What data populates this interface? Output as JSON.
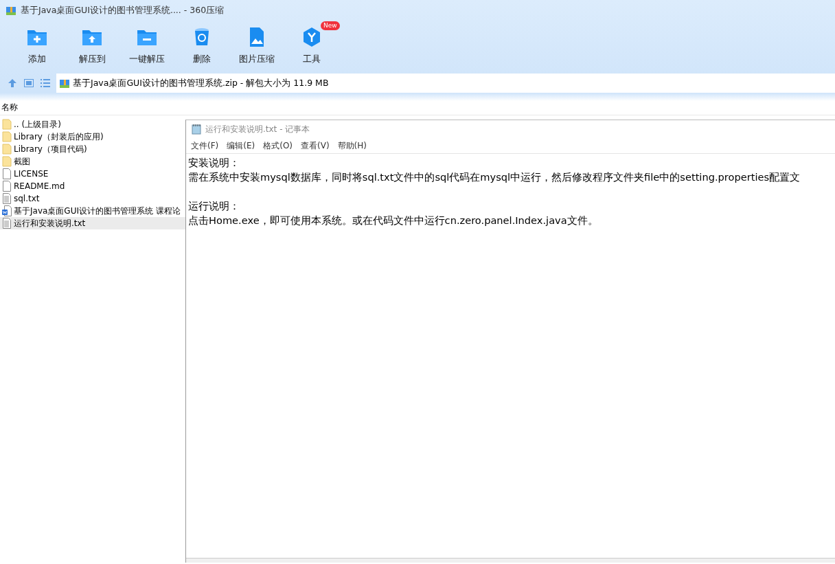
{
  "window": {
    "title": "基于Java桌面GUI设计的图书管理系统.... - 360压缩"
  },
  "toolbar": [
    {
      "label": "添加",
      "kind": "add"
    },
    {
      "label": "解压到",
      "kind": "extract"
    },
    {
      "label": "一键解压",
      "kind": "quick"
    },
    {
      "label": "删除",
      "kind": "delete"
    },
    {
      "label": "图片压缩",
      "kind": "image"
    },
    {
      "label": "工具",
      "kind": "tools",
      "badge": "New"
    }
  ],
  "address_bar": {
    "value": "基于Java桌面GUI设计的图书管理系统.zip - 解包大小为 11.9 MB"
  },
  "file_list": {
    "column": "名称",
    "items": [
      {
        "name": ".. (上级目录)",
        "kind": "folder",
        "selected": false
      },
      {
        "name": "Library（封装后的应用)",
        "kind": "folder",
        "selected": false
      },
      {
        "name": "Library（项目代码)",
        "kind": "folder",
        "selected": false
      },
      {
        "name": "截图",
        "kind": "folder",
        "selected": false
      },
      {
        "name": "LICENSE",
        "kind": "file",
        "selected": false
      },
      {
        "name": "README.md",
        "kind": "file",
        "selected": false
      },
      {
        "name": "sql.txt",
        "kind": "text",
        "selected": false
      },
      {
        "name": "基于Java桌面GUI设计的图书管理系统 课程论",
        "kind": "doc",
        "selected": false
      },
      {
        "name": "运行和安装说明.txt",
        "kind": "text",
        "selected": true
      }
    ]
  },
  "notepad": {
    "title": "运行和安装说明.txt - 记事本",
    "menu": [
      "文件(F)",
      "编辑(E)",
      "格式(O)",
      "查看(V)",
      "帮助(H)"
    ],
    "sections": [
      {
        "lines": [
          "安装说明：",
          "需在系统中安装mysql数据库，同时将sql.txt文件中的sql代码在mysql中运行，然后修改程序文件夹file中的setting.properties配置文"
        ]
      },
      {
        "lines": [
          "运行说明：",
          "点击Home.exe，即可使用本系统。或在代码文件中运行cn.zero.panel.Index.java文件。"
        ]
      }
    ]
  }
}
